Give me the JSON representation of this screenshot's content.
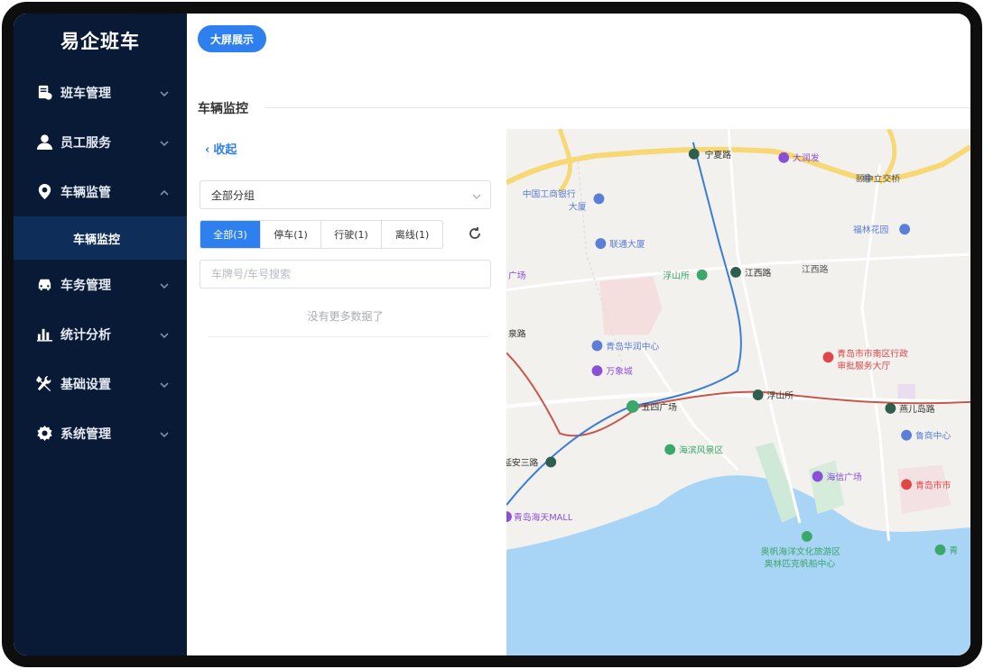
{
  "app": {
    "title": "易企班车"
  },
  "sidebar": {
    "items": [
      {
        "label": "班车管理",
        "icon": "bus-doc-icon",
        "expanded": false
      },
      {
        "label": "员工服务",
        "icon": "user-icon",
        "expanded": false
      },
      {
        "label": "车辆监管",
        "icon": "location-pin-icon",
        "expanded": true
      },
      {
        "label": "车务管理",
        "icon": "car-icon",
        "expanded": false
      },
      {
        "label": "统计分析",
        "icon": "bar-chart-icon",
        "expanded": false
      },
      {
        "label": "基础设置",
        "icon": "wrench-icon",
        "expanded": false
      },
      {
        "label": "系统管理",
        "icon": "gear-icon",
        "expanded": false
      }
    ],
    "submenu": {
      "active_label": "车辆监控"
    }
  },
  "header": {
    "big_screen_button": "大屏展示"
  },
  "section": {
    "title": "车辆监控"
  },
  "panel": {
    "collapse_label": "收起",
    "group_select": {
      "value": "全部分组"
    },
    "status_tabs": [
      {
        "label": "全部(3)",
        "active": true
      },
      {
        "label": "停车(1)",
        "active": false
      },
      {
        "label": "行驶(1)",
        "active": false
      },
      {
        "label": "离线(1)",
        "active": false
      }
    ],
    "search": {
      "placeholder": "车牌号/车号搜索"
    },
    "empty_text": "没有更多数据了"
  },
  "map": {
    "labels": {
      "l1": "宁夏路",
      "l2": "大润发",
      "l3": "中国工商银行",
      "l4": "大厦",
      "l5": "颐中立交桥",
      "l6": "福林花园",
      "l7": "联通大厦",
      "l8": "广场",
      "l9": "浮山所",
      "l10": "江西路",
      "l11": "江西路",
      "l12": "泉路",
      "l13": "青岛华润中心",
      "l14": "万象城",
      "l15": "青岛市市南区行政",
      "l16": "审批服务大厅",
      "l17": "浮山所",
      "l18": "五四广场",
      "l19": "燕儿岛路",
      "l20": "海滨风景区",
      "l21": "鲁商中心",
      "l22": "延安三路",
      "l23": "海信广场",
      "l24": "青岛市市",
      "l25": "青岛海天MALL",
      "l26": "奥帆海洋文化旅游区",
      "l27": "奥林匹克帆船中心",
      "l28": "青"
    },
    "colors": {
      "land": "#f2f1ee",
      "sea": "#a8d4f5",
      "metro_blue": "#3a7bd5",
      "metro_red": "#c8564a",
      "highway": "#f7d875"
    }
  }
}
